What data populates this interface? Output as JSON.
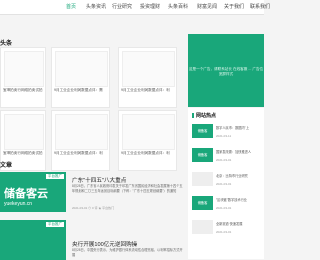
{
  "nav": {
    "items": [
      "首页",
      "头条资讯",
      "行业研究",
      "投资理财",
      "头条百科",
      "财富见闻",
      "关于我们",
      "联系我们"
    ],
    "active_index": 0,
    "active_color": "#19a77a"
  },
  "sections": {
    "headlines_label": "头条",
    "articles_label": "文章"
  },
  "cards": [
    "宝坤拍卖行网络拍卖试拍",
    "9月工业企业利润数据点评：需",
    "9月工业企业利润数据点评：利",
    "宝坤拍卖行网络拍卖试拍",
    "9月工业企业利润数据点评：利",
    "9月工业企业利润数据点评：利",
    "9月社会零售消费数据点评",
    "9月社会零售消费数据点评"
  ],
  "banner": {
    "text": "这是一个广告，请联系站长 在线客服 ... 广告位 宽屏样式"
  },
  "sidebar": {
    "title": "网站热点",
    "items": [
      {
        "thumb": "储备客",
        "text": "数字人民币：数据内\"上",
        "date": "2021-03-11"
      },
      {
        "thumb": "储备客",
        "text": "国家发改委：加快推进人",
        "date": "2021-03-01"
      },
      {
        "thumb": "",
        "text": "北京：比特币行业研究",
        "date": "2021-03-01"
      },
      {
        "thumb": "储备客",
        "text": "\"区块链\"数字技术行业",
        "date": "2021-03-01"
      },
      {
        "thumb": "",
        "text": "全新赛道 快速发展",
        "date": "2021-03-01"
      }
    ]
  },
  "articles": [
    {
      "image_text_top": "平台推广",
      "image_text_main": "储备客云",
      "image_text_sub": "yuekeyun.cn",
      "title": "广东\"十四五\"八大重点",
      "desc": "8月28日，广东省人民政府印发关于印发广东省国民经济和社会发展第十四个五年规划和二〇三五年远景目标纲要（下称：\"广东十四五规划纲要\"）的通知",
      "meta": "2021-03-01  ⊙ 0 评  ★ 平台热门"
    },
    {
      "image_text_top": "平台推广",
      "image_text_main": "",
      "image_text_sub": "",
      "title": "央行开展100亿元逆回购操",
      "desc": "8月28日，中国央行表示，为维护银行体系流动性合理充裕，以利率招标方式开展",
      "meta": "2021-03-01"
    }
  ]
}
